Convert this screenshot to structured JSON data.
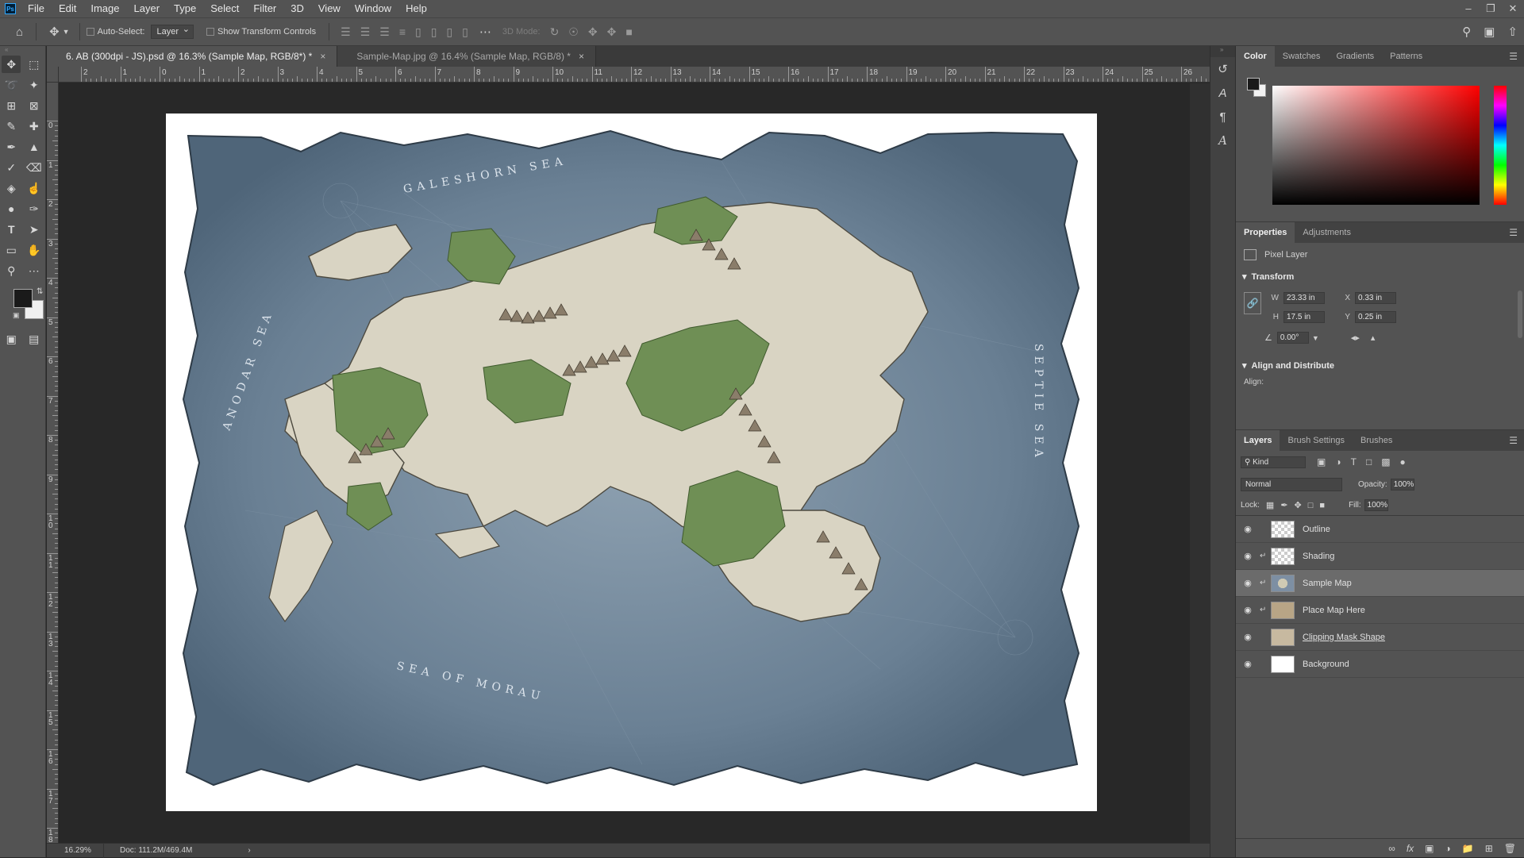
{
  "menu": {
    "items": [
      "File",
      "Edit",
      "Image",
      "Layer",
      "Type",
      "Select",
      "Filter",
      "3D",
      "View",
      "Window",
      "Help"
    ]
  },
  "options_bar": {
    "auto_select_label": "Auto-Select:",
    "auto_select_target": "Layer",
    "show_transform_label": "Show Transform Controls",
    "mode_label": "3D Mode:"
  },
  "tabs": [
    {
      "label": "6. AB (300dpi - JS).psd @ 16.3% (Sample Map, RGB/8*) *",
      "active": true
    },
    {
      "label": "Sample-Map.jpg @ 16.4% (Sample Map, RGB/8) *",
      "active": false
    }
  ],
  "ruler": {
    "h_labels": [
      "2",
      "1",
      "0",
      "1",
      "2",
      "3",
      "4",
      "5",
      "6",
      "7",
      "8",
      "9",
      "10",
      "11",
      "12",
      "13",
      "14",
      "15",
      "16",
      "17",
      "18",
      "19",
      "20",
      "21",
      "22",
      "23",
      "24",
      "25",
      "26"
    ],
    "v_labels": [
      "0",
      "1",
      "2",
      "3",
      "4",
      "5",
      "6",
      "7",
      "8",
      "9",
      "1 0",
      "1 1",
      "1 2",
      "1 3",
      "1 4",
      "1 5",
      "1 6",
      "1 7",
      "1 8"
    ]
  },
  "map": {
    "labels": {
      "north_sea": "GALESHORN SEA",
      "west_sea": "ANODAR SEA",
      "south_sea": "SEA OF MORAU",
      "east_sea": "SEPTIE SEA"
    },
    "colors": {
      "sea": "#5d7488",
      "land": "#d9d4c3",
      "forest": "#6f8f55",
      "paper": "#ffffff"
    }
  },
  "status": {
    "zoom": "16.29%",
    "doc": "Doc: 111.2M/469.4M"
  },
  "color_panel": {
    "tabs": [
      "Color",
      "Swatches",
      "Gradients",
      "Patterns"
    ],
    "active_tab": "Color"
  },
  "properties_panel": {
    "tabs": [
      "Properties",
      "Adjustments"
    ],
    "layer_type": "Pixel Layer",
    "transform_title": "Transform",
    "w_label": "W",
    "w_value": "23.33 in",
    "x_label": "X",
    "x_value": "0.33 in",
    "h_label": "H",
    "h_value": "17.5 in",
    "y_label": "Y",
    "y_value": "0.25 in",
    "angle_value": "0.00°",
    "align_title": "Align and Distribute",
    "align_label": "Align:"
  },
  "layers_panel": {
    "tabs": [
      "Layers",
      "Brush Settings",
      "Brushes"
    ],
    "kind_label": "Kind",
    "blend_mode": "Normal",
    "opacity_label": "Opacity:",
    "opacity_value": "100%",
    "lock_label": "Lock:",
    "fill_label": "Fill:",
    "fill_value": "100%",
    "layers": [
      {
        "name": "Outline",
        "thumb": "checker",
        "clipped": false,
        "selected": false
      },
      {
        "name": "Shading",
        "thumb": "checker",
        "clipped": true,
        "selected": false
      },
      {
        "name": "Sample Map",
        "thumb": "map",
        "clipped": true,
        "selected": true
      },
      {
        "name": "Place Map Here",
        "thumb": "parch",
        "clipped": true,
        "selected": false
      },
      {
        "name": "Clipping Mask Shape",
        "thumb": "clipshape",
        "clipped": false,
        "selected": false
      },
      {
        "name": "Background",
        "thumb": "white",
        "clipped": false,
        "selected": false
      }
    ]
  }
}
